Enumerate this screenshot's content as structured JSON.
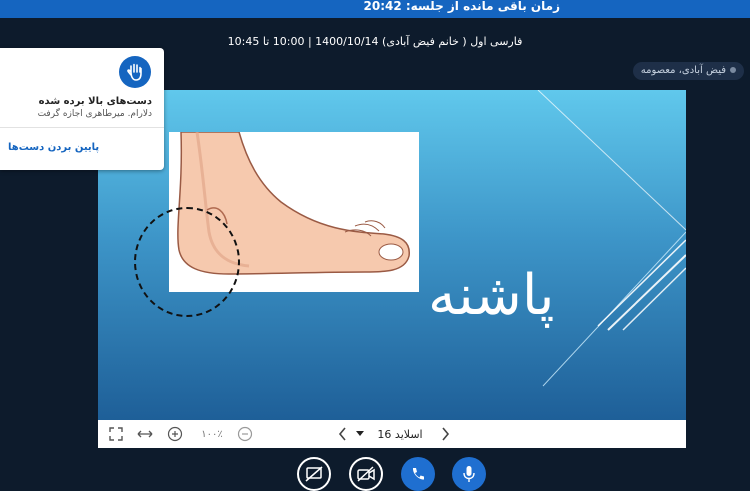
{
  "header": {
    "time_remaining": "زمان باقی مانده از جلسه: 20:42",
    "meeting_title": "فارسی اول ( خانم فیض آبادی) 1400/10/14 | 10:00 تا 10:45"
  },
  "presenter": {
    "name": "فیض آبادی، معصومه"
  },
  "slide": {
    "word": "پاشنه"
  },
  "raised_hands": {
    "title": "دست‌های بالا برده شده",
    "subtitle": "دلارام. میرطاهری اجازه گرفت",
    "lower_button": "پایین بردن دست‌ها"
  },
  "toolbar": {
    "zoom": "۱۰۰٪",
    "slide_label": "اسلاید 16"
  },
  "colors": {
    "accent": "#1565c0",
    "background": "#0d1b2c",
    "slide_top": "#60c8ec",
    "slide_bottom": "#1e5f98"
  },
  "icons": [
    "hand-icon",
    "fullscreen-icon",
    "fit-width-icon",
    "zoom-in-icon",
    "zoom-out-icon",
    "chevron-left-icon",
    "chevron-right-icon",
    "chevron-down-icon",
    "screen-share-off-icon",
    "camera-off-icon",
    "phone-icon",
    "microphone-icon"
  ]
}
